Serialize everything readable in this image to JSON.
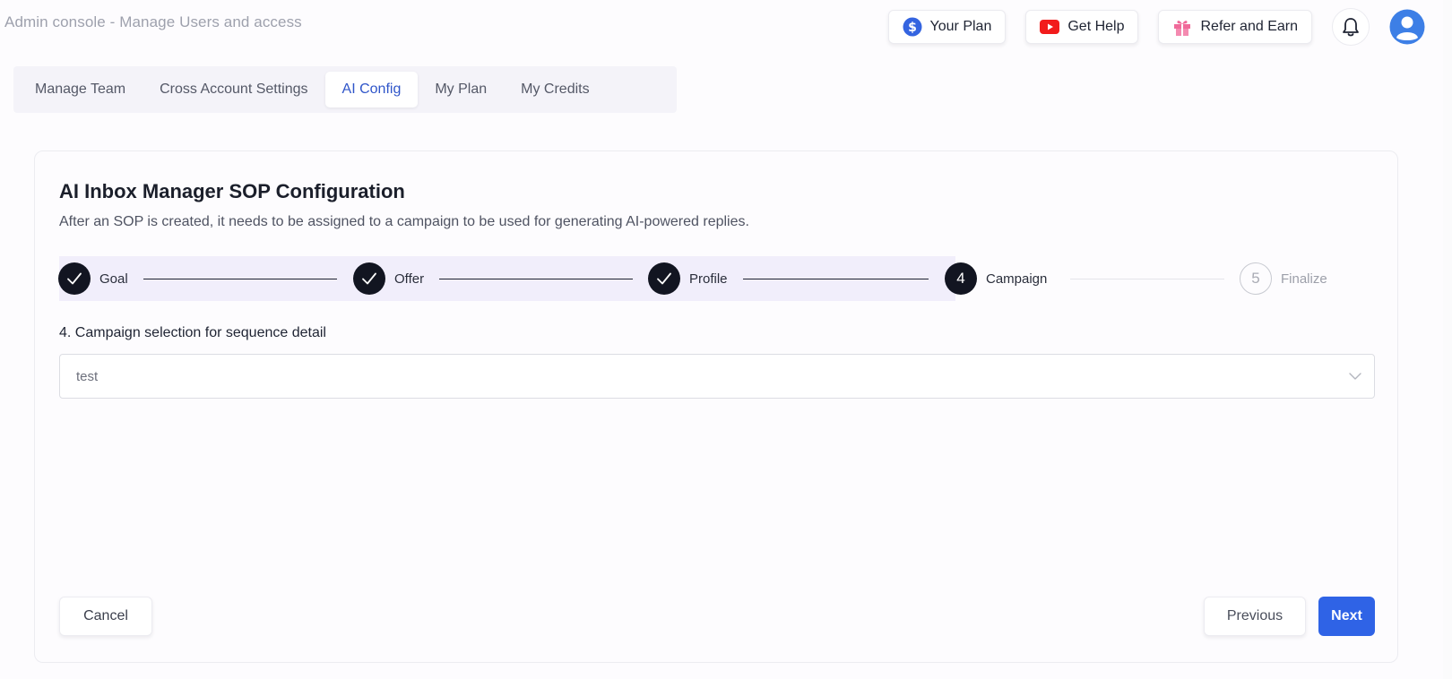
{
  "header": {
    "title": "Admin console - Manage Users and access",
    "buttons": [
      {
        "label": "Your Plan",
        "icon": "dollar-icon"
      },
      {
        "label": "Get Help",
        "icon": "youtube-icon"
      },
      {
        "label": "Refer and Earn",
        "icon": "gift-icon"
      }
    ]
  },
  "tabs": [
    {
      "label": "Manage Team"
    },
    {
      "label": "Cross Account Settings"
    },
    {
      "label": "AI Config",
      "active": true
    },
    {
      "label": "My Plan"
    },
    {
      "label": "My Credits"
    }
  ],
  "card": {
    "title": "AI Inbox Manager SOP Configuration",
    "subtitle": "After an SOP is created, it needs to be assigned to a campaign to be used for generating AI-powered replies."
  },
  "stepper": {
    "steps": [
      {
        "label": "Goal",
        "state": "done"
      },
      {
        "label": "Offer",
        "state": "done"
      },
      {
        "label": "Profile",
        "state": "done"
      },
      {
        "label": "Campaign",
        "number": "4",
        "state": "current"
      },
      {
        "label": "Finalize",
        "number": "5",
        "state": "pending"
      }
    ]
  },
  "form": {
    "field_label": "4. Campaign selection for sequence detail",
    "campaign_value": "test"
  },
  "actions": {
    "cancel": "Cancel",
    "previous": "Previous",
    "next": "Next"
  },
  "colors": {
    "accent": "#2f63e6",
    "active_tab_text": "#2f55c9",
    "step_done": "#121521",
    "stepper_background": "#f1eefb"
  }
}
